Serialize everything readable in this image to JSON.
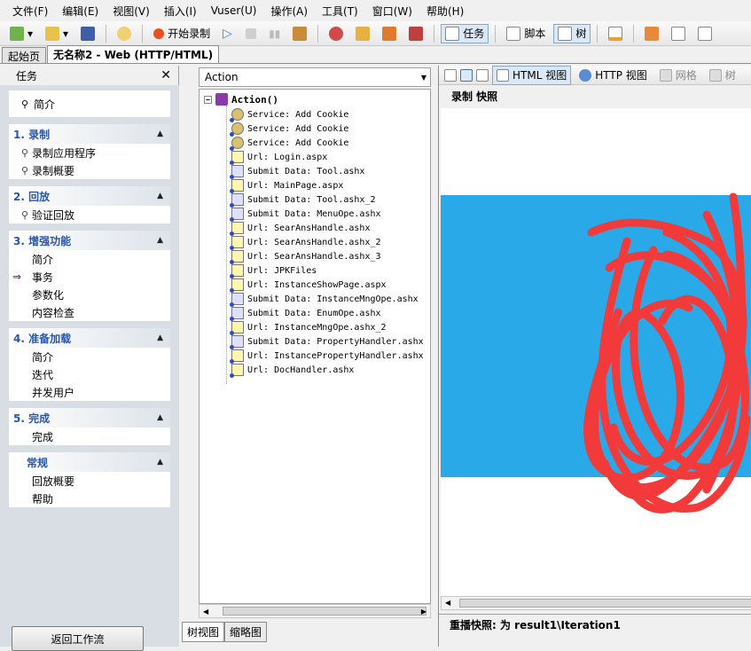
{
  "menu": [
    "文件(F)",
    "编辑(E)",
    "视图(V)",
    "插入(I)",
    "Vuser(U)",
    "操作(A)",
    "工具(T)",
    "窗口(W)",
    "帮助(H)"
  ],
  "toolbar": {
    "start_record": "开始录制",
    "tasks": "任务",
    "script": "脚本",
    "tree": "树"
  },
  "tabs": [
    "起始页",
    "无名称2 - Web (HTTP/HTML)"
  ],
  "taskpane": {
    "title": "任务",
    "intro": "简介",
    "sections": [
      {
        "title": "1. 录制",
        "items": [
          "录制应用程序",
          "录制概要"
        ]
      },
      {
        "title": "2. 回放",
        "items": [
          "验证回放"
        ]
      },
      {
        "title": "3. 增强功能",
        "items": [
          "简介",
          "事务",
          "参数化",
          "内容检查"
        ]
      },
      {
        "title": "4. 准备加载",
        "items": [
          "简介",
          "迭代",
          "并发用户"
        ]
      },
      {
        "title": "5. 完成",
        "items": [
          "完成"
        ]
      },
      {
        "title": "常规",
        "items": [
          "回放概要",
          "帮助"
        ]
      }
    ],
    "back_button": "返回工作流"
  },
  "tree": {
    "action_selected": "Action",
    "root": "Action()",
    "nodes": [
      {
        "type": "svc",
        "text": "Service: Add Cookie"
      },
      {
        "type": "svc",
        "text": "Service: Add Cookie"
      },
      {
        "type": "svc",
        "text": "Service: Add Cookie"
      },
      {
        "type": "url",
        "text": "Url: Login.aspx"
      },
      {
        "type": "sub",
        "text": "Submit Data: Tool.ashx"
      },
      {
        "type": "url",
        "text": "Url: MainPage.aspx"
      },
      {
        "type": "sub",
        "text": "Submit Data: Tool.ashx_2"
      },
      {
        "type": "sub",
        "text": "Submit Data: MenuOpe.ashx"
      },
      {
        "type": "url",
        "text": "Url: SearAnsHandle.ashx"
      },
      {
        "type": "url",
        "text": "Url: SearAnsHandle.ashx_2"
      },
      {
        "type": "url",
        "text": "Url: SearAnsHandle.ashx_3"
      },
      {
        "type": "url",
        "text": "Url: JPKFiles"
      },
      {
        "type": "url",
        "text": "Url: InstanceShowPage.aspx"
      },
      {
        "type": "sub",
        "text": "Submit Data: InstanceMngOpe.ashx"
      },
      {
        "type": "sub",
        "text": "Submit Data: EnumOpe.ashx"
      },
      {
        "type": "url",
        "text": "Url: InstanceMngOpe.ashx_2"
      },
      {
        "type": "sub",
        "text": "Submit Data: PropertyHandler.ashx"
      },
      {
        "type": "url",
        "text": "Url: InstancePropertyHandler.ashx"
      },
      {
        "type": "url",
        "text": "Url: DocHandler.ashx"
      }
    ],
    "view_tabs": [
      "树视图",
      "缩略图"
    ]
  },
  "snapshot": {
    "view_html": "HTML 视图",
    "view_http": "HTTP 视图",
    "grid": "网格",
    "tree": "树",
    "title": "录制 快照",
    "replay_status": "重播快照: 为 result1\\Iteration1"
  },
  "colors": {
    "section_title": "#2a56a8",
    "snapshot_blue": "#29a9e8",
    "scribble_red": "#f23a3a"
  }
}
